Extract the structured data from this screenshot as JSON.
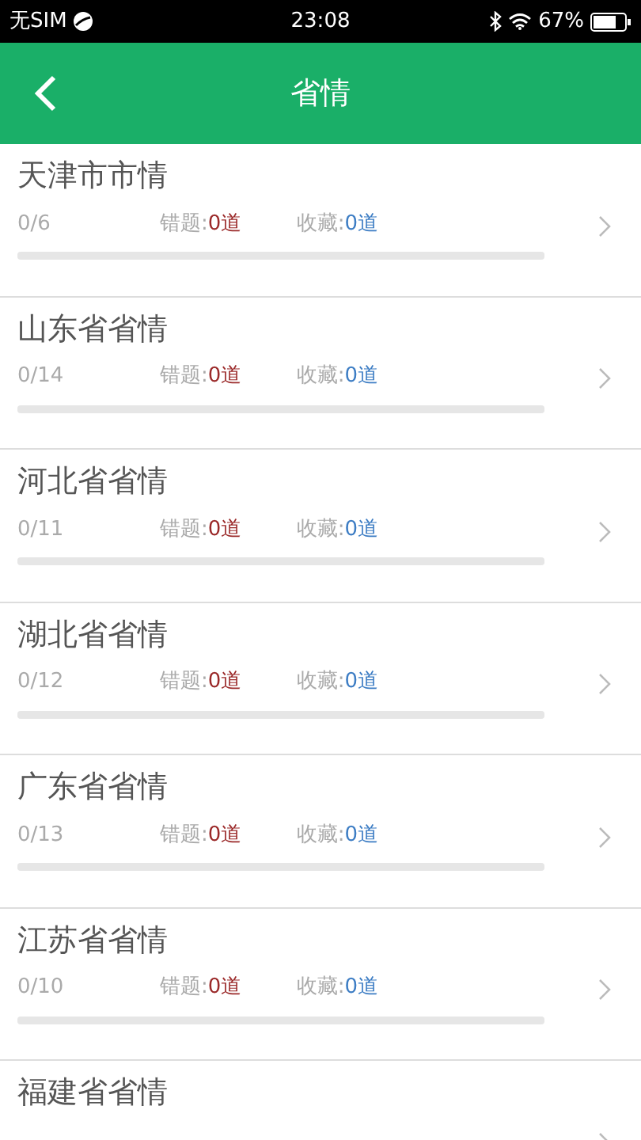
{
  "status_bar": {
    "carrier": "无SIM",
    "time": "23:08",
    "battery": "67%"
  },
  "header": {
    "back": true,
    "title": "省情"
  },
  "items": [
    {
      "title": "天津市市情",
      "progress": "0/6",
      "level": 0,
      "wrong_label": "错题:",
      "wrong_count": "0道",
      "fav_label": "收藏:",
      "fav_count": "0道"
    },
    {
      "title": "山东省省情",
      "progress": "0/14",
      "level": 0,
      "wrong_label": "错题:",
      "wrong_count": "0道",
      "fav_label": "收藏:",
      "fav_count": "0道"
    },
    {
      "title": "河北省省情",
      "progress": "0/11",
      "level": 0,
      "wrong_label": "错题:",
      "wrong_count": "0道",
      "fav_label": "收藏:",
      "fav_count": "0道"
    },
    {
      "title": "湖北省省情",
      "progress": "0/12",
      "level": 0,
      "wrong_label": "错题:",
      "wrong_count": "0道",
      "fav_label": "收藏:",
      "fav_count": "0道"
    },
    {
      "title": "广东省省情",
      "progress": "0/13",
      "level": 0,
      "wrong_label": "错题:",
      "wrong_count": "0道",
      "fav_label": "收藏:",
      "fav_count": "0道"
    },
    {
      "title": "江苏省省情",
      "progress": "0/10",
      "level": 0,
      "wrong_label": "错题:",
      "wrong_count": "0道",
      "fav_label": "收藏:",
      "fav_count": "0道"
    },
    {
      "title": "福建省省情"
    }
  ]
}
